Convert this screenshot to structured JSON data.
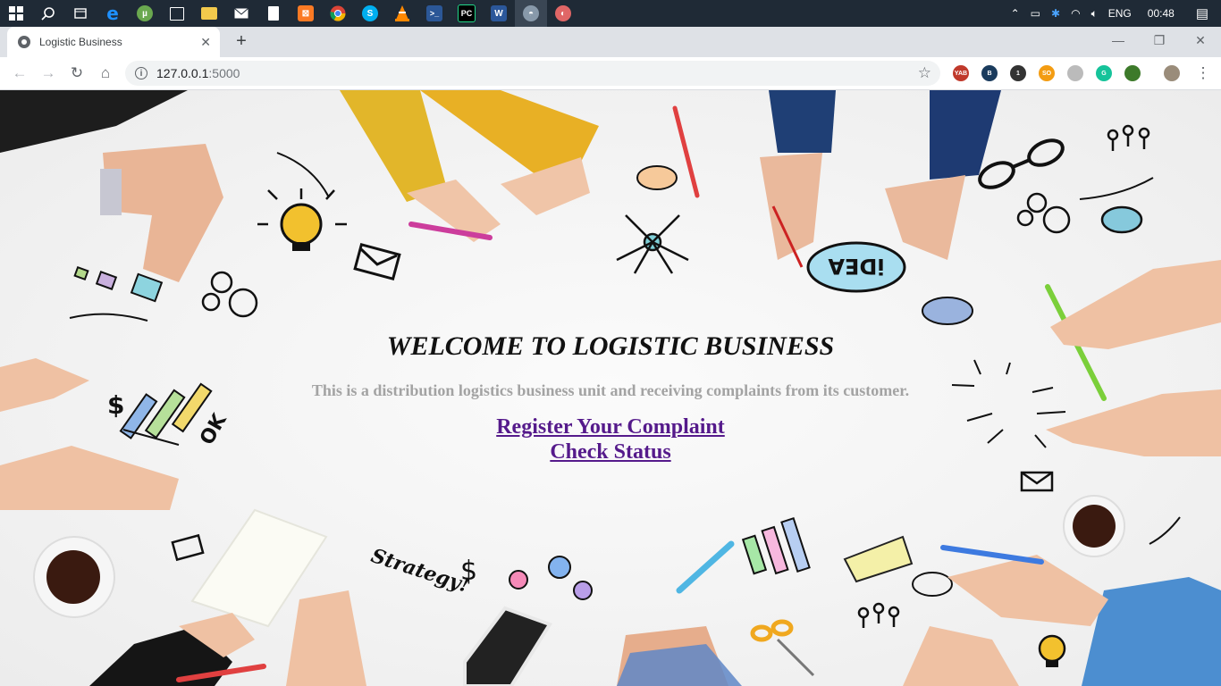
{
  "taskbar": {
    "language": "ENG",
    "time": "00:48",
    "apps": [
      {
        "icon": "windows-start-icon",
        "color": "#ffffff"
      },
      {
        "icon": "search-icon",
        "color": "#ffffff"
      },
      {
        "icon": "task-view-icon",
        "color": "#ffffff"
      },
      {
        "icon": "edge-icon",
        "color": "#1e90ff"
      },
      {
        "icon": "torrent-icon",
        "color": "#6aa84f"
      },
      {
        "icon": "store-icon",
        "color": "#ffffff"
      },
      {
        "icon": "file-explorer-icon",
        "color": "#f2c94c"
      },
      {
        "icon": "mail-icon",
        "color": "#ffffff"
      },
      {
        "icon": "document-icon",
        "color": "#ffffff"
      },
      {
        "icon": "xampp-icon",
        "color": "#fb7a24"
      },
      {
        "icon": "chrome-icon",
        "color": "#34a853"
      },
      {
        "icon": "skype-icon",
        "color": "#00aff0"
      },
      {
        "icon": "vlc-icon",
        "color": "#ff8800"
      },
      {
        "icon": "powershell-icon",
        "color": "#2b5797"
      },
      {
        "icon": "pycharm-icon",
        "color": "#21d789"
      },
      {
        "icon": "word-icon",
        "color": "#2b579a"
      },
      {
        "icon": "app-icon",
        "color": "#8899aa"
      },
      {
        "icon": "paint-icon",
        "color": "#e06666"
      }
    ]
  },
  "browser": {
    "tab_title": "Logistic Business",
    "url_host": "127.0.0.1",
    "url_port": ":5000",
    "extensions": [
      {
        "icon": "yab-extension-icon",
        "label": "YAB",
        "color": "#c0392b"
      },
      {
        "icon": "b-extension-icon",
        "label": "B",
        "color": "#1a3b5d"
      },
      {
        "icon": "box-extension-icon",
        "label": "1",
        "color": "#333333"
      },
      {
        "icon": "so-extension-icon",
        "label": "SO",
        "color": "#f39c12"
      },
      {
        "icon": "moon-extension-icon",
        "label": "",
        "color": "#bbbbbb"
      },
      {
        "icon": "grammarly-extension-icon",
        "label": "G",
        "color": "#15c39a"
      },
      {
        "icon": "globe-extension-icon",
        "label": "",
        "color": "#3d7a2a"
      },
      {
        "icon": "profile-avatar-icon",
        "label": "",
        "color": "#9a8c7a"
      }
    ]
  },
  "page": {
    "heading": "WELCOME TO LOGISTIC BUSINESS",
    "subtitle": "This is a distribution logistics business unit and receiving complaints from its customer.",
    "links": [
      {
        "label": "Register Your Complaint"
      },
      {
        "label": "Check Status"
      }
    ],
    "illustrations": {
      "idea_text": "iDEA",
      "strategy_text": "Strategy!",
      "ok_text": "OK"
    }
  }
}
